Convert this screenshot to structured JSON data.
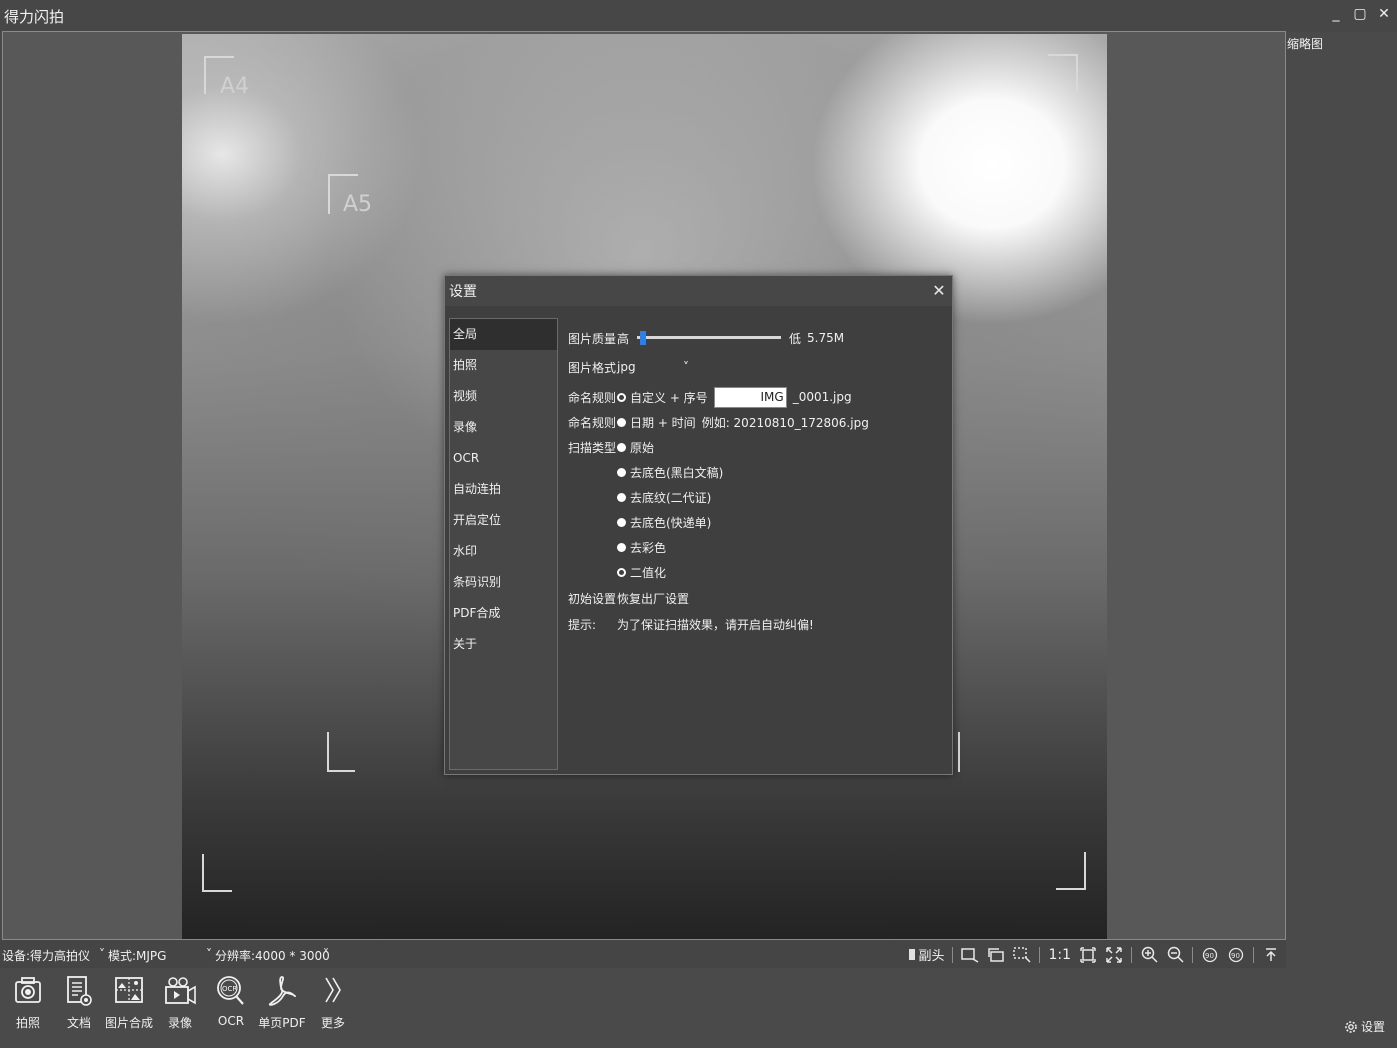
{
  "window": {
    "title": "得力闪拍",
    "minimize": "_",
    "maximize": "▢",
    "close": "✕"
  },
  "preview": {
    "paper_labels": [
      "A4",
      "A5"
    ],
    "thumbnail_label": "缩略图"
  },
  "status_bar": {
    "device": "设备:得力高拍仪",
    "mode": "模式:MJPG",
    "resolution": "分辨率:4000 * 3000",
    "dropdown_caret": "˅",
    "sub_camera": "副头",
    "ratio_1_1": "1:1"
  },
  "toolbar": {
    "buttons": [
      {
        "label": "拍照",
        "icon": "camera-icon"
      },
      {
        "label": "文档",
        "icon": "document-icon"
      },
      {
        "label": "图片合成",
        "icon": "image-merge-icon"
      },
      {
        "label": "录像",
        "icon": "video-icon"
      },
      {
        "label": "OCR",
        "icon": "ocr-icon"
      },
      {
        "label": "单页PDF",
        "icon": "pdf-icon"
      },
      {
        "label": "更多",
        "icon": "more-icon"
      }
    ],
    "settings_label": "设置"
  },
  "dialog": {
    "title": "设置",
    "close": "✕",
    "nav": [
      "全局",
      "拍照",
      "视频",
      "录像",
      "OCR",
      "自动连拍",
      "开启定位",
      "水印",
      "条码识别",
      "PDF合成",
      "关于"
    ],
    "active_nav": "全局",
    "quality": {
      "label": "图片质量",
      "high": "高",
      "low": "低",
      "size": "5.75M",
      "level": 0.02
    },
    "format": {
      "label": "图片格式",
      "value": "jpg",
      "caret": "˅"
    },
    "naming_custom": {
      "label": "命名规则",
      "option": "自定义 + 序号",
      "input_value": "IMG",
      "suffix": "_0001.jpg",
      "selected": true
    },
    "naming_date": {
      "label": "命名规则",
      "option": "日期 + 时间",
      "example": "例如: 20210810_172806.jpg",
      "selected": false
    },
    "scan_type": {
      "label": "扫描类型",
      "options": [
        {
          "label": "原始",
          "selected": false
        },
        {
          "label": "去底色(黑白文稿)",
          "selected": false
        },
        {
          "label": "去底纹(二代证)",
          "selected": false
        },
        {
          "label": "去底色(快递单)",
          "selected": false
        },
        {
          "label": "去彩色",
          "selected": false
        },
        {
          "label": "二值化",
          "selected": true
        }
      ]
    },
    "init": {
      "label": "初始设置",
      "action": "恢复出厂设置"
    },
    "tip": {
      "label": "提示:",
      "text": "为了保证扫描效果，请开启自动纠偏!"
    }
  }
}
